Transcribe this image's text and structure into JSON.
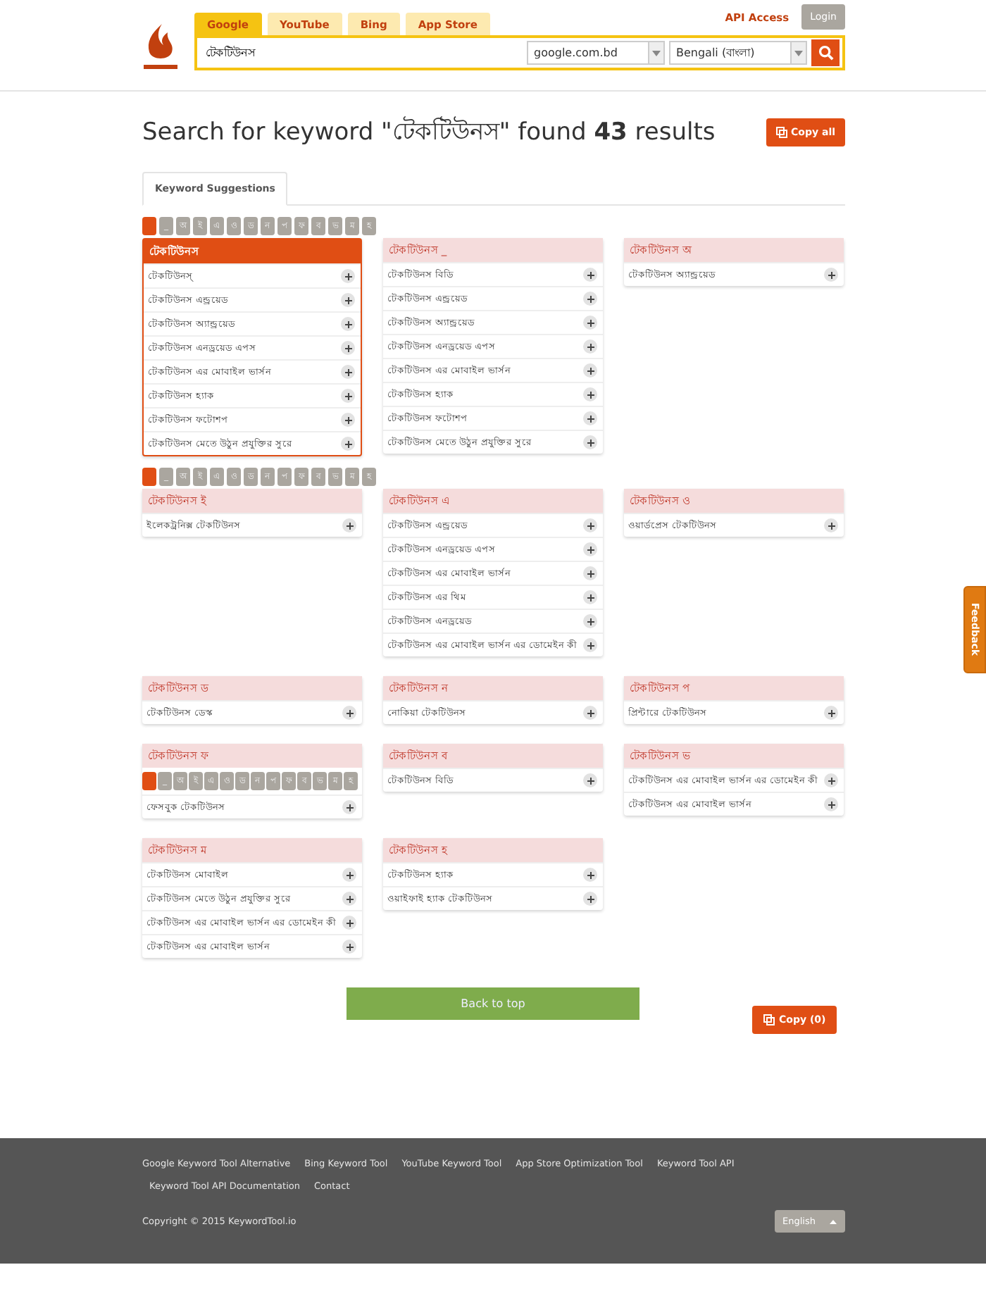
{
  "header": {
    "tabs": [
      {
        "label": "Google",
        "selected": true
      },
      {
        "label": "YouTube",
        "selected": false
      },
      {
        "label": "Bing",
        "selected": false
      },
      {
        "label": "App Store",
        "selected": false
      }
    ],
    "api_link": "API Access",
    "login": "Login",
    "search": {
      "value": "টেকটিউনস",
      "country": "google.com.bd",
      "language": "Bengali (বাংলা)"
    }
  },
  "title": {
    "before": "Search for keyword \"টেকটিউনস\" found ",
    "count": "43",
    "after": " results"
  },
  "copy_all": "Copy all",
  "result_tabs": [
    {
      "label": "Keyword Suggestions",
      "selected": true
    }
  ],
  "sections": [
    {
      "kind": "nav",
      "letters": [
        {
          "selected": true
        },
        {
          "label": "_",
          "selected": false
        },
        {
          "label": "অ",
          "selected": false
        },
        {
          "label": "ই",
          "selected": false
        },
        {
          "label": "এ",
          "selected": false
        },
        {
          "label": "ও",
          "selected": false
        },
        {
          "label": "ড",
          "selected": false
        },
        {
          "label": "ন",
          "selected": false
        },
        {
          "label": "প",
          "selected": false
        },
        {
          "label": "ফ",
          "selected": false
        },
        {
          "label": "ব",
          "selected": false
        },
        {
          "label": "ভ",
          "selected": false
        },
        {
          "label": "ম",
          "selected": false
        },
        {
          "label": "হ",
          "selected": false
        }
      ]
    },
    {
      "kind": "cards",
      "cards": [
        {
          "title": "টেকটিউনস",
          "selected": true,
          "items": [
            "টেকটিউনস্",
            "টেকটিউনস এন্ড্রয়েড",
            "টেকটিউনস অ্যান্ড্রয়েড",
            "টেকটিউনস এনড্রয়েড এপস",
            "টেকটিউনস এর মোবাইল ভার্সন",
            "টেকটিউনস হ্যাক",
            "টেকটিউনস ফটোশপ",
            "টেকটিউনস মেতে উঠুন প্রযুক্তির সুরে"
          ]
        },
        {
          "title": "টেকটিউনস _",
          "selected": false,
          "items": [
            "টেকটিউনস বিডি",
            "টেকটিউনস এন্ড্রয়েড",
            "টেকটিউনস অ্যান্ড্রয়েড",
            "টেকটিউনস এনড্রয়েড এপস",
            "টেকটিউনস এর মোবাইল ভার্সন",
            "টেকটিউনস হ্যাক",
            "টেকটিউনস ফটোশপ",
            "টেকটিউনস মেতে উঠুন প্রযুক্তির সুরে"
          ]
        },
        {
          "title": "টেকটিউনস অ",
          "selected": false,
          "items": [
            "টেকটিউনস অ্যান্ড্রয়েড"
          ]
        }
      ]
    },
    {
      "kind": "nav",
      "letters": [
        {
          "selected": true
        },
        {
          "label": "_",
          "selected": false
        },
        {
          "label": "অ",
          "selected": false
        },
        {
          "label": "ই",
          "selected": false
        },
        {
          "label": "এ",
          "selected": false
        },
        {
          "label": "ও",
          "selected": false
        },
        {
          "label": "ড",
          "selected": false
        },
        {
          "label": "ন",
          "selected": false
        },
        {
          "label": "প",
          "selected": false
        },
        {
          "label": "ফ",
          "selected": false
        },
        {
          "label": "ব",
          "selected": false
        },
        {
          "label": "ভ",
          "selected": false
        },
        {
          "label": "ম",
          "selected": false
        },
        {
          "label": "হ",
          "selected": false
        }
      ]
    },
    {
      "kind": "cards",
      "cards": [
        {
          "title": "টেকটিউনস ই",
          "selected": false,
          "items": [
            "ইলেকট্রনিক্স টেকটিউনস"
          ]
        },
        {
          "title": "টেকটিউনস এ",
          "selected": false,
          "items": [
            "টেকটিউনস এন্ড্রয়েড",
            "টেকটিউনস এনড্রয়েড এপস",
            "টেকটিউনস এর মোবাইল ভার্সন",
            "টেকটিউনস এর থিম",
            "টেকটিউনস এনড্রয়েড",
            "টেকটিউনস এর মোবাইল ভার্সন এর ডোমেইন কী"
          ]
        },
        {
          "title": "টেকটিউনস ও",
          "selected": false,
          "items": [
            "ওয়ার্ডপ্রেস টেকটিউনস"
          ]
        }
      ]
    },
    {
      "kind": "cards",
      "cards": [
        {
          "title": "টেকটিউনস ড",
          "selected": false,
          "items": [
            "টেকটিউনস ডেস্ক"
          ]
        },
        {
          "title": "টেকটিউনস ন",
          "selected": false,
          "items": [
            "নোকিয়া টেকটিউনস"
          ]
        },
        {
          "title": "টেকটিউনস প",
          "selected": false,
          "items": [
            "প্রিন্টারে টেকটিউনস"
          ]
        }
      ]
    },
    {
      "kind": "cards",
      "cards": [
        {
          "title": "টেকটিউনস ফ",
          "selected": false,
          "covering_nav": [
            {
              "selected": true
            },
            {
              "label": "_",
              "selected": false
            },
            {
              "label": "অ",
              "selected": false
            },
            {
              "label": "ই",
              "selected": false
            },
            {
              "label": "এ",
              "selected": false
            },
            {
              "label": "ও",
              "selected": false
            },
            {
              "label": "ড",
              "selected": false
            },
            {
              "label": "ন",
              "selected": false
            },
            {
              "label": "প",
              "selected": false
            },
            {
              "label": "ফ",
              "selected": false
            },
            {
              "label": "ব",
              "selected": false
            },
            {
              "label": "ভ",
              "selected": false
            },
            {
              "label": "ম",
              "selected": false
            },
            {
              "label": "হ",
              "selected": false
            }
          ],
          "items": [
            "ফেসবুক টেকটিউনস"
          ]
        },
        {
          "title": "টেকটিউনস ব",
          "selected": false,
          "items": [
            "টেকটিউনস বিডি"
          ]
        },
        {
          "title": "টেকটিউনস ভ",
          "selected": false,
          "items": [
            "টেকটিউনস এর মোবাইল ভার্সন এর ডোমেইন কী",
            "টেকটিউনস এর মোবাইল ভার্সন"
          ]
        }
      ]
    },
    {
      "kind": "cards",
      "cards": [
        {
          "title": "টেকটিউনস ম",
          "selected": false,
          "items": [
            "টেকটিউনস মোবাইল",
            "টেকটিউনস মেতে উঠুন প্রযুক্তির সুরে",
            "টেকটিউনস এর মোবাইল ভার্সন এর ডোমেইন কী",
            "টেকটিউনস এর মোবাইল ভার্সন"
          ]
        },
        {
          "title": "টেকটিউনস হ",
          "selected": false,
          "items": [
            "টেকটিউনস হ্যাক",
            "ওয়াইফাই হ্যাক টেকটিউনস"
          ]
        }
      ]
    }
  ],
  "back_to_top": "Back to top",
  "copy_button": "Copy (0)",
  "feedback": "Feedback",
  "footer": {
    "links": [
      "Google Keyword Tool Alternative",
      "Bing Keyword Tool",
      "YouTube Keyword Tool",
      "App Store Optimization Tool",
      "Keyword Tool API",
      "Keyword Tool API Documentation",
      "Contact"
    ],
    "copyright": "Copyright © 2015 KeywordTool.io",
    "language": "English"
  }
}
